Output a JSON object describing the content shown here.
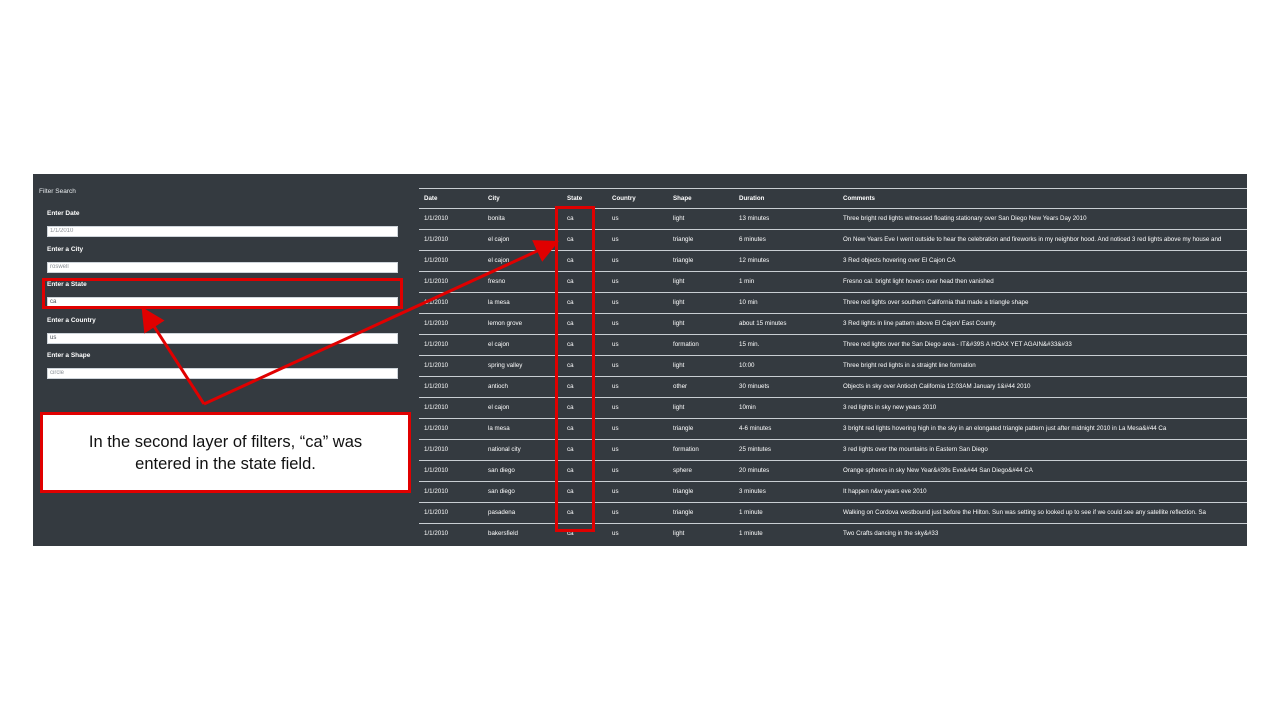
{
  "sidebar": {
    "title": "Filter Search",
    "filters": [
      {
        "label": "Enter Date",
        "value": "",
        "placeholder": "1/1/2010"
      },
      {
        "label": "Enter a City",
        "value": "",
        "placeholder": "roswell"
      },
      {
        "label": "Enter a State",
        "value": "ca",
        "placeholder": ""
      },
      {
        "label": "Enter a Country",
        "value": "us",
        "placeholder": ""
      },
      {
        "label": "Enter a Shape",
        "value": "",
        "placeholder": "circle"
      }
    ]
  },
  "table": {
    "headers": [
      "Date",
      "City",
      "State",
      "Country",
      "Shape",
      "Duration",
      "Comments"
    ],
    "rows": [
      [
        "1/1/2010",
        "bonita",
        "ca",
        "us",
        "light",
        "13 minutes",
        "Three bright red lights witnessed floating stationary over San Diego New Years Day 2010"
      ],
      [
        "1/1/2010",
        "el cajon",
        "ca",
        "us",
        "triangle",
        "6 minutes",
        "On New Years Eve I went outside to hear the celebration and fireworks in my neighbor hood. And noticed 3 red lights above my house and"
      ],
      [
        "1/1/2010",
        "el cajon",
        "ca",
        "us",
        "triangle",
        "12 minutes",
        "3 Red objects hovering over El Cajon CA"
      ],
      [
        "1/1/2010",
        "fresno",
        "ca",
        "us",
        "light",
        "1 min",
        "Fresno cal. bright light hovers over head then vanished"
      ],
      [
        "1/1/2010",
        "la mesa",
        "ca",
        "us",
        "light",
        "10 min",
        "Three red lights over southern California that made a triangle shape"
      ],
      [
        "1/1/2010",
        "lemon grove",
        "ca",
        "us",
        "light",
        "about 15 minutes",
        "3 Red lights in line pattern above El Cajon/ East County."
      ],
      [
        "1/1/2010",
        "el cajon",
        "ca",
        "us",
        "formation",
        "15 min.",
        "Three red lights over the San Diego area - IT&#39S A HOAX YET AGAIN&#33&#33"
      ],
      [
        "1/1/2010",
        "spring valley",
        "ca",
        "us",
        "light",
        "10:00",
        "Three bright red lights in a straight line formation"
      ],
      [
        "1/1/2010",
        "antioch",
        "ca",
        "us",
        "other",
        "30 minuets",
        "Objects in sky over Antioch California 12:03AM January 1&#44 2010"
      ],
      [
        "1/1/2010",
        "el cajon",
        "ca",
        "us",
        "light",
        "10min",
        "3 red lights in sky new years 2010"
      ],
      [
        "1/1/2010",
        "la mesa",
        "ca",
        "us",
        "triangle",
        "4-6 minutes",
        "3 bright red lights hovering high in the sky in an elongated triangle pattern just after midnight 2010 in La Mesa&#44 Ca"
      ],
      [
        "1/1/2010",
        "national city",
        "ca",
        "us",
        "formation",
        "25 mintutes",
        "3 red lights over the mountains in Eastern San Diego"
      ],
      [
        "1/1/2010",
        "san diego",
        "ca",
        "us",
        "sphere",
        "20 minutes",
        "Orange spheres in sky New Year&#39s Eve&#44 San Diego&#44 CA"
      ],
      [
        "1/1/2010",
        "san diego",
        "ca",
        "us",
        "triangle",
        "3 minutes",
        "It happen n&w years eve 2010"
      ],
      [
        "1/1/2010",
        "pasadena",
        "ca",
        "us",
        "triangle",
        "1 minute",
        "Walking on Cordova westbound just before the Hilton. Sun was setting so looked up to see if we could see any satellite reflection. Sa"
      ],
      [
        "1/1/2010",
        "bakersfield",
        "ca",
        "us",
        "light",
        "1 minute",
        "Two Crafts dancing in the sky&#33"
      ]
    ]
  },
  "annotation": {
    "text": "In the second layer of filters, “ca” was entered in the state field.",
    "highlight_color": "#e00000"
  },
  "colors": {
    "background": "#343a40",
    "text": "#ffffff",
    "row_border": "#c9ced3"
  }
}
